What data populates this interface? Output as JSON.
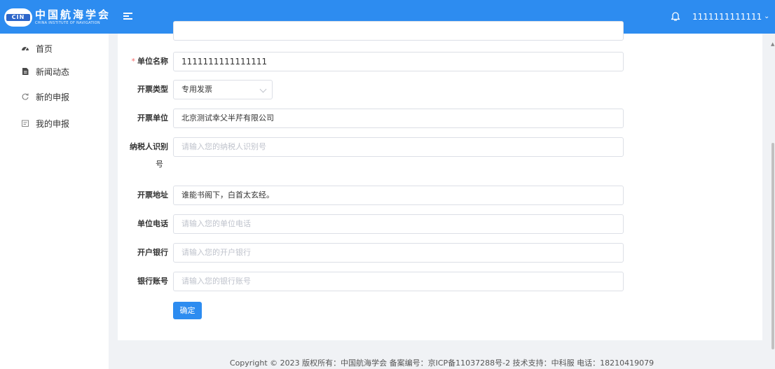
{
  "header": {
    "logo_badge": "CIN",
    "logo_cn": "中国航海学会",
    "logo_en": "CHINA INSTITUTE OF NAVIGATION",
    "user_name": "1111111111111",
    "user_caret": "⌄",
    "accent_color": "#2d8cf0"
  },
  "sidebar": {
    "items": [
      {
        "label": "首页",
        "icon": "dashboard-icon"
      },
      {
        "label": "新闻动态",
        "icon": "document-icon"
      },
      {
        "label": "新的申报",
        "icon": "refresh-icon"
      },
      {
        "label": "我的申报",
        "icon": "report-icon"
      }
    ]
  },
  "form": {
    "required_mark": "*",
    "unit_name": {
      "label": "单位名称",
      "value": "1111111111111111"
    },
    "invoice_type": {
      "label": "开票类型",
      "value": "专用发票"
    },
    "invoice_unit": {
      "label": "开票单位",
      "value": "北京测试幸父半芹有限公司"
    },
    "taxpayer_id": {
      "label_line1": "纳税人识别",
      "label_line2": "号",
      "placeholder": "请输入您的纳税人识别号"
    },
    "invoice_address": {
      "label": "开票地址",
      "value": "谁能书阁下，白首太玄经。"
    },
    "unit_phone": {
      "label": "单位电话",
      "placeholder": "请输入您的单位电话"
    },
    "bank": {
      "label": "开户银行",
      "placeholder": "请输入您的开户银行"
    },
    "account": {
      "label": "银行账号",
      "placeholder": "请输入您的银行账号"
    },
    "confirm_label": "确定"
  },
  "footer": {
    "text": "Copyright © 2023 版权所有：中国航海学会 备案编号：京ICP备11037288号-2 技术支持：中科服  电话：18210419079"
  }
}
